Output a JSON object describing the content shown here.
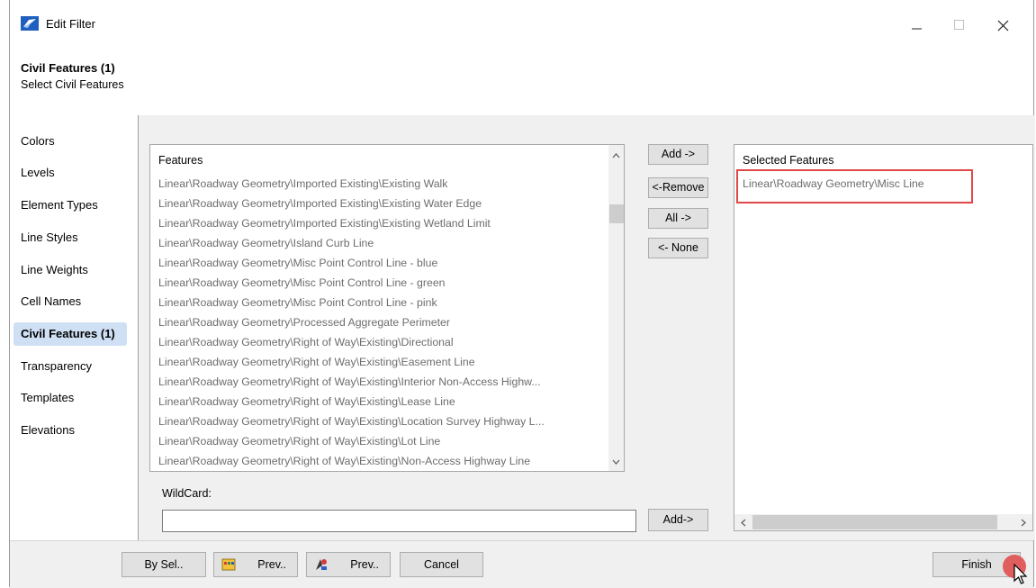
{
  "window": {
    "title": "Edit Filter",
    "icon": "app-icon",
    "controls": {
      "minimize": "—",
      "maximize": "☐",
      "close": "✕"
    }
  },
  "header": {
    "title": "Civil Features (1)",
    "subtitle": "Select Civil Features"
  },
  "sidebar": {
    "items": [
      {
        "label": "Colors"
      },
      {
        "label": "Levels"
      },
      {
        "label": "Element Types"
      },
      {
        "label": "Line Styles"
      },
      {
        "label": "Line Weights"
      },
      {
        "label": "Cell Names"
      },
      {
        "label": "Civil Features (1)",
        "active": true
      },
      {
        "label": "Transparency"
      },
      {
        "label": "Templates"
      },
      {
        "label": "Elevations"
      }
    ]
  },
  "features_list": {
    "header": "Features",
    "items": [
      "Linear\\Roadway Geometry\\Imported Existing\\Existing Walk",
      "Linear\\Roadway Geometry\\Imported Existing\\Existing Water Edge",
      "Linear\\Roadway Geometry\\Imported Existing\\Existing Wetland Limit",
      "Linear\\Roadway Geometry\\Island Curb Line",
      "Linear\\Roadway Geometry\\Misc Point Control Line - blue",
      "Linear\\Roadway Geometry\\Misc Point Control Line - green",
      "Linear\\Roadway Geometry\\Misc Point Control Line - pink",
      "Linear\\Roadway Geometry\\Processed Aggregate Perimeter",
      "Linear\\Roadway Geometry\\Right of Way\\Existing\\Directional",
      "Linear\\Roadway Geometry\\Right of Way\\Existing\\Easement Line",
      "Linear\\Roadway Geometry\\Right of Way\\Existing\\Interior Non-Access Highw...",
      "Linear\\Roadway Geometry\\Right of Way\\Existing\\Lease Line",
      "Linear\\Roadway Geometry\\Right of Way\\Existing\\Location Survey Highway L...",
      "Linear\\Roadway Geometry\\Right of Way\\Existing\\Lot Line",
      "Linear\\Roadway Geometry\\Right of Way\\Existing\\Non-Access Highway Line"
    ]
  },
  "middle_buttons": {
    "add": "Add ->",
    "remove": "<-Remove",
    "all": "All ->",
    "none": "<- None"
  },
  "selected_list": {
    "header": "Selected Features",
    "items": [
      "Linear\\Roadway Geometry\\Misc Line"
    ]
  },
  "wildcard": {
    "label": "WildCard:",
    "value": "",
    "add_button": "Add->"
  },
  "footer": {
    "by_sel": "By Sel..",
    "prev1": "Prev..",
    "prev2": "Prev..",
    "cancel": "Cancel",
    "finish": "Finish"
  },
  "colors": {
    "highlight_box": "#e04848",
    "active_nav_bg": "#cfe0f5",
    "list_text": "#6d6d6d"
  }
}
